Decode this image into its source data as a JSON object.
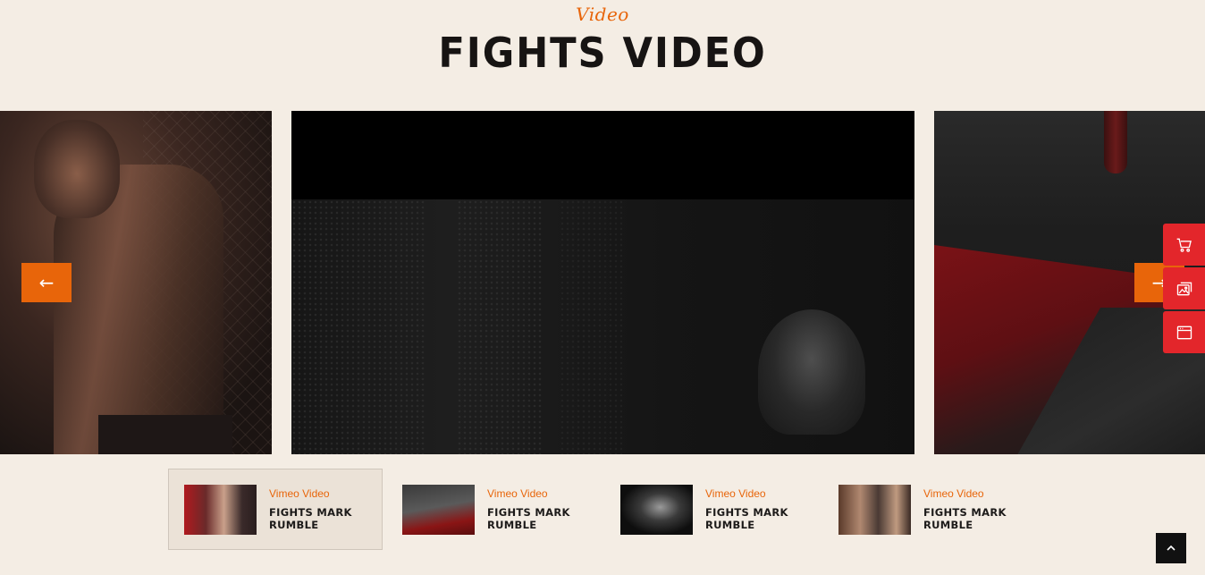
{
  "section": {
    "subtitle": "Video",
    "title": "FIGHTS VIDEO"
  },
  "slider": {
    "prev_icon": "arrow-left-icon",
    "next_icon": "arrow-right-icon",
    "prev_label": "←",
    "next_label": "→"
  },
  "side_tools": [
    {
      "icon": "cart-icon"
    },
    {
      "icon": "images-icon"
    },
    {
      "icon": "browser-window-icon"
    }
  ],
  "thumbnails": [
    {
      "tag": "Vimeo Video",
      "title": "FIGHTS MARK RUMBLE",
      "active": true
    },
    {
      "tag": "Vimeo Video",
      "title": "FIGHTS MARK RUMBLE",
      "active": false
    },
    {
      "tag": "Vimeo Video",
      "title": "FIGHTS MARK RUMBLE",
      "active": false
    },
    {
      "tag": "Vimeo Video",
      "title": "FIGHTS MARK RUMBLE",
      "active": false
    }
  ],
  "colors": {
    "accent": "#e8650a",
    "side_tool": "#e3262b",
    "background": "#f4ede4"
  },
  "back_to_top": {
    "icon": "chevron-up-icon"
  }
}
